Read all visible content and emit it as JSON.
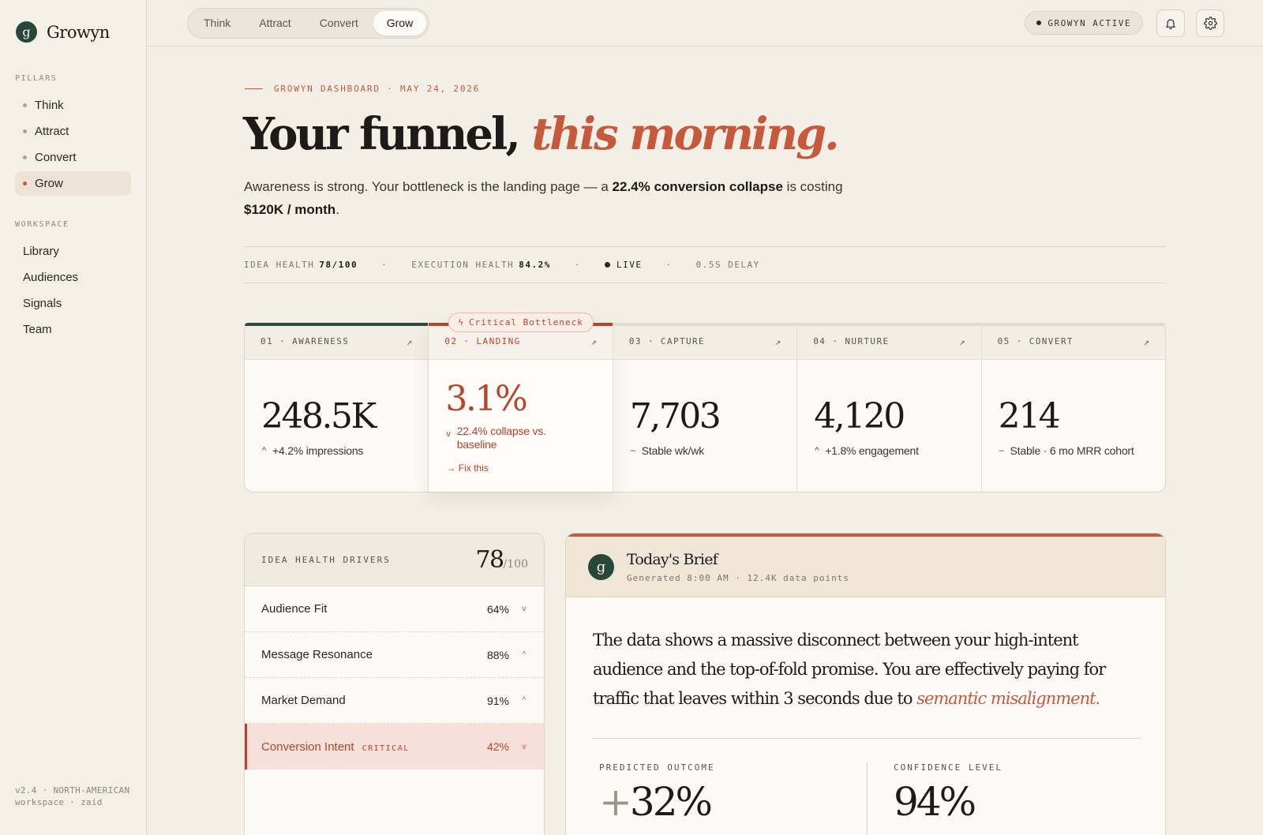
{
  "brand": {
    "logo_letter": "g",
    "name": "Growyn"
  },
  "sidebar": {
    "pillars_title": "PILLARS",
    "pillars": [
      {
        "label": "Think",
        "active": false
      },
      {
        "label": "Attract",
        "active": false
      },
      {
        "label": "Convert",
        "active": false
      },
      {
        "label": "Grow",
        "active": true
      }
    ],
    "workspace_title": "WORKSPACE",
    "workspace": [
      {
        "label": "Library"
      },
      {
        "label": "Audiences"
      },
      {
        "label": "Signals"
      },
      {
        "label": "Team"
      }
    ],
    "footer": "v2.4 · NORTH-AMERICAN workspace · zaid"
  },
  "topbar": {
    "tabs": [
      {
        "label": "Think"
      },
      {
        "label": "Attract"
      },
      {
        "label": "Convert"
      },
      {
        "label": "Grow",
        "active": true
      }
    ],
    "status": "GROWYN ACTIVE"
  },
  "hero": {
    "eyebrow": "GROWYN DASHBOARD · MAY 24, 2026",
    "title_plain": "Your funnel,",
    "title_em": "this morning.",
    "sub_1": "Awareness is strong. Your bottleneck is the landing page — a ",
    "sub_b1": "22.4% conversion collapse",
    "sub_2": " is costing ",
    "sub_b2": "$120K / month",
    "sub_3": "."
  },
  "health": {
    "idea_label": "IDEA HEALTH",
    "idea_value": "78/100",
    "exec_label": "EXECUTION HEALTH",
    "exec_value": "84.2%",
    "live": "LIVE",
    "delay": "0.5S DELAY",
    "sep": "·"
  },
  "funnel": {
    "critical_badge": "Critical Bottleneck",
    "stages": [
      {
        "label": "01 · AWARENESS",
        "value": "248.5K",
        "delta_symbol": "^",
        "delta": "+4.2% impressions"
      },
      {
        "label": "02 · LANDING",
        "value": "3.1%",
        "delta_symbol": "v",
        "delta": "22.4% collapse vs. baseline",
        "action": "→ Fix this"
      },
      {
        "label": "03 · CAPTURE",
        "value": "7,703",
        "delta_symbol": "–",
        "delta": "Stable wk/wk"
      },
      {
        "label": "04 · NURTURE",
        "value": "4,120",
        "delta_symbol": "^",
        "delta": "+1.8% engagement"
      },
      {
        "label": "05 · CONVERT",
        "value": "214",
        "delta_symbol": "–",
        "delta": "Stable · 6 mo MRR cohort"
      }
    ],
    "arrow": "↗"
  },
  "drivers": {
    "title": "IDEA HEALTH DRIVERS",
    "score": "78",
    "score_max": "/100",
    "rows": [
      {
        "label": "Audience Fit",
        "value": "64%",
        "chevron": "v"
      },
      {
        "label": "Message Resonance",
        "value": "88%",
        "chevron": "^"
      },
      {
        "label": "Market Demand",
        "value": "91%",
        "chevron": "^"
      },
      {
        "label": "Conversion Intent",
        "tag": "CRITICAL",
        "value": "42%",
        "chevron": "v"
      }
    ]
  },
  "brief": {
    "logo_letter": "g",
    "title": "Today's Brief",
    "meta": "Generated 8:00 AM · 12.4K data points",
    "body": "The data shows a massive disconnect between your high-intent audience and the top-of-fold promise. You are effectively paying for traffic that leaves within 3 seconds due to ",
    "body_em": "semantic misalignment.",
    "metric_1_label": "PREDICTED OUTCOME",
    "metric_1_prefix": "+",
    "metric_1_value": "32%",
    "metric_2_label": "CONFIDENCE LEVEL",
    "metric_2_value": "94%"
  },
  "colors": {
    "accent": "#c4593c",
    "brand_green": "#28473b",
    "critical": "#b8432a",
    "background": "#f3efe6"
  }
}
